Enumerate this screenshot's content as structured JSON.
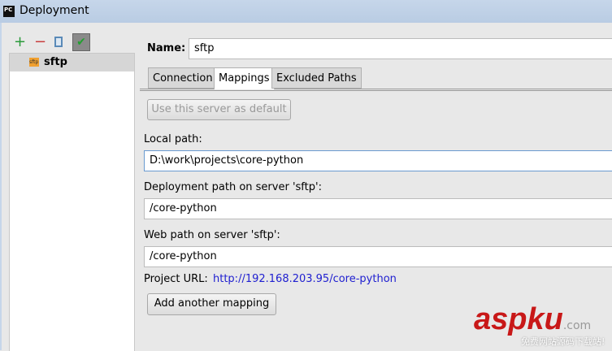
{
  "window": {
    "title": "Deployment",
    "app_icon": "PC"
  },
  "toolbar": {
    "add": "+",
    "remove": "−"
  },
  "servers": [
    {
      "name": "sftp",
      "icon": "sftp"
    }
  ],
  "name_label": "Name:",
  "name_value": "sftp",
  "tabs": [
    {
      "label": "Connection"
    },
    {
      "label": "Mappings"
    },
    {
      "label": "Excluded Paths"
    }
  ],
  "default_button": "Use this server as default",
  "local_path_label": "Local path:",
  "local_path": "D:\\work\\projects\\core-python",
  "deploy_path_label": "Deployment path on server 'sftp':",
  "deploy_path": "/core-python",
  "web_path_label": "Web path on server 'sftp':",
  "web_path": "/core-python",
  "project_url_label": "Project URL:",
  "project_url": "http://192.168.203.95/core-python",
  "add_mapping_button": "Add another mapping",
  "watermark": {
    "brand": "aspku",
    "suffix": ".com",
    "tagline": "免费网站源码下载站!"
  }
}
